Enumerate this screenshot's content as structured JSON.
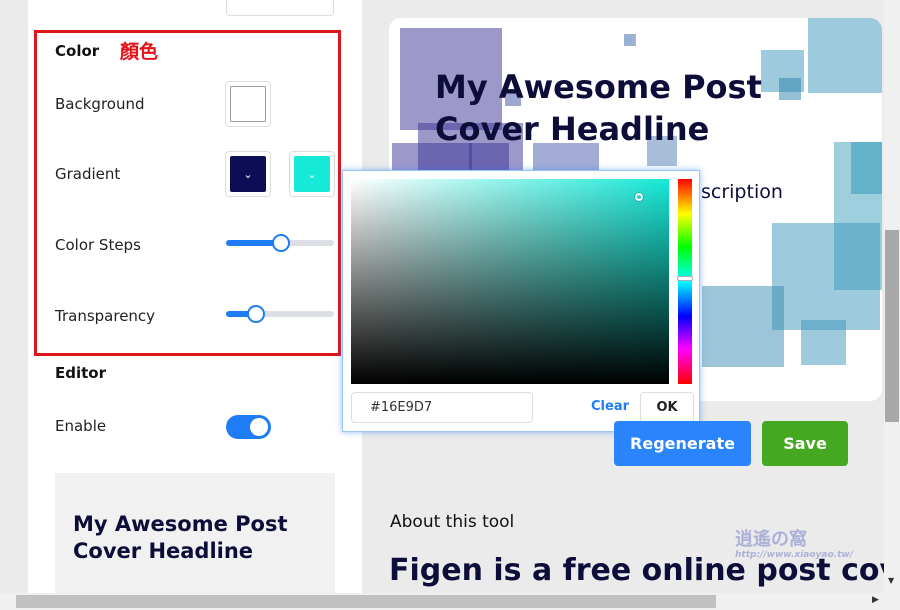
{
  "settings": {
    "color_section": {
      "title": "Color",
      "annotation": "顏色",
      "background_label": "Background",
      "background_color": "#ffffff",
      "gradient_label": "Gradient",
      "gradient_start": "#0d0d55",
      "gradient_end": "#16E9D7",
      "color_steps_label": "Color Steps",
      "color_steps_value": 0.52,
      "transparency_label": "Transparency",
      "transparency_value": 0.3
    },
    "editor_section": {
      "title": "Editor",
      "enable_label": "Enable",
      "enabled": true
    },
    "mini_preview_title": "My Awesome Post Cover Headline"
  },
  "preview": {
    "headline": "My Awesome Post Cover Headline",
    "description": "scription"
  },
  "color_picker": {
    "hex_value": "#16E9D7",
    "clear_label": "Clear",
    "ok_label": "OK"
  },
  "actions": {
    "regenerate_label": "Regenerate",
    "save_label": "Save"
  },
  "about": {
    "heading": "About this tool",
    "title": "Figen is a free online post cover"
  },
  "colors": {
    "accent": "#1e7cf5",
    "save": "#44a820",
    "highlight_box": "#e0151b",
    "headline": "#0d0d3a"
  },
  "watermark": {
    "text": "逍遙の窩",
    "url": "http://www.xiaoyao.tw/"
  }
}
